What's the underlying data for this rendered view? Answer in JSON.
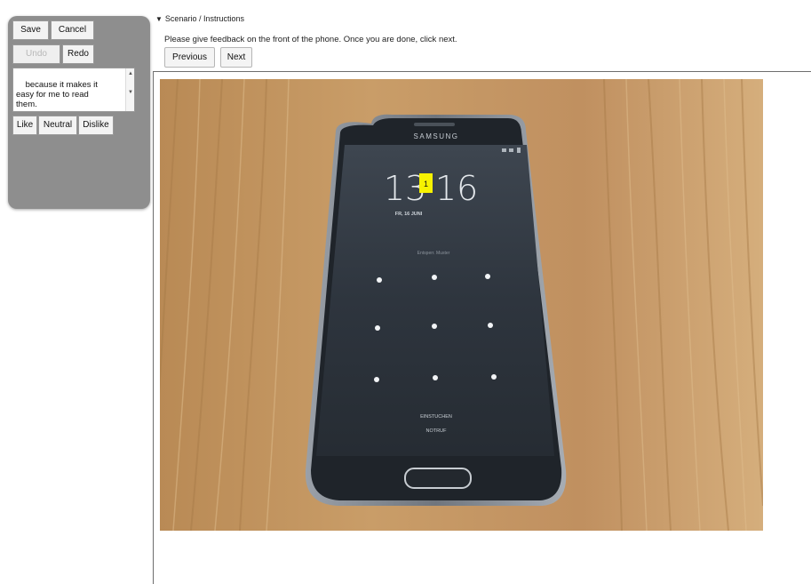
{
  "panel": {
    "save_label": "Save",
    "cancel_label": "Cancel",
    "undo_label": "Undo",
    "redo_label": "Redo",
    "comment_text": "because it makes it\neasy for me to read\nthem.",
    "like_label": "Like",
    "neutral_label": "Neutral",
    "dislike_label": "Dislike"
  },
  "scenario": {
    "toggle_label": "Scenario / Instructions",
    "instructions": "Please give feedback on the front of the phone. Once you are done, click next.",
    "previous_label": "Previous",
    "next_label": "Next"
  },
  "photo": {
    "brand": "SAMSUNG",
    "clock_hours": "13",
    "clock_minutes": "16",
    "highlight_marker": "1",
    "date_text": "FR, 16 JUNI",
    "lock_hint": "Entsperr. Muster",
    "bottom_line1": "EINSTUCHEN",
    "bottom_line2": "NOTRUF",
    "highlight_color": "#f7f200"
  }
}
